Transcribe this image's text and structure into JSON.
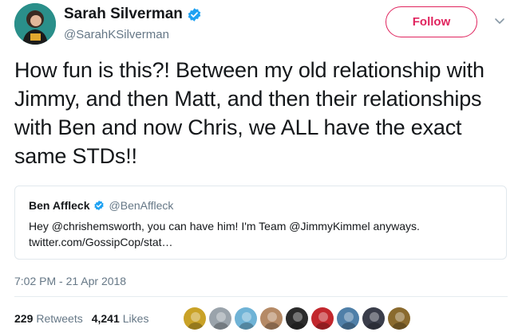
{
  "author": {
    "display_name": "Sarah Silverman",
    "handle": "@SarahKSilverman",
    "verified": true
  },
  "follow_label": "Follow",
  "tweet_text": "How fun is this?!  Between my old relationship with Jimmy, and then Matt, and then their relationships with Ben and now Chris, we ALL have the exact same STDs!!",
  "quoted_tweet": {
    "display_name": "Ben Affleck",
    "handle": "@BenAffleck",
    "verified": true,
    "text": "Hey @chrishemsworth, you can have him! I'm Team @JimmyKimmel anyways. twitter.com/GossipCop/stat…"
  },
  "timestamp": "7:02 PM - 21 Apr 2018",
  "stats": {
    "retweets_count": "229",
    "retweets_label": "Retweets",
    "likes_count": "4,241",
    "likes_label": "Likes"
  },
  "colors": {
    "follow_accent": "#e0245e",
    "verified_blue": "#1da1f2",
    "muted_text": "#657786"
  },
  "icons": {
    "verified": "verified-badge-icon",
    "caret": "chevron-down-icon"
  },
  "liker_avatar_colors": [
    "#c9a227",
    "#9aa3ab",
    "#6fb3d6",
    "#b58a66",
    "#2b2b2b",
    "#c2272d",
    "#4f7fa8",
    "#3a3d4a",
    "#8a6a2e"
  ]
}
